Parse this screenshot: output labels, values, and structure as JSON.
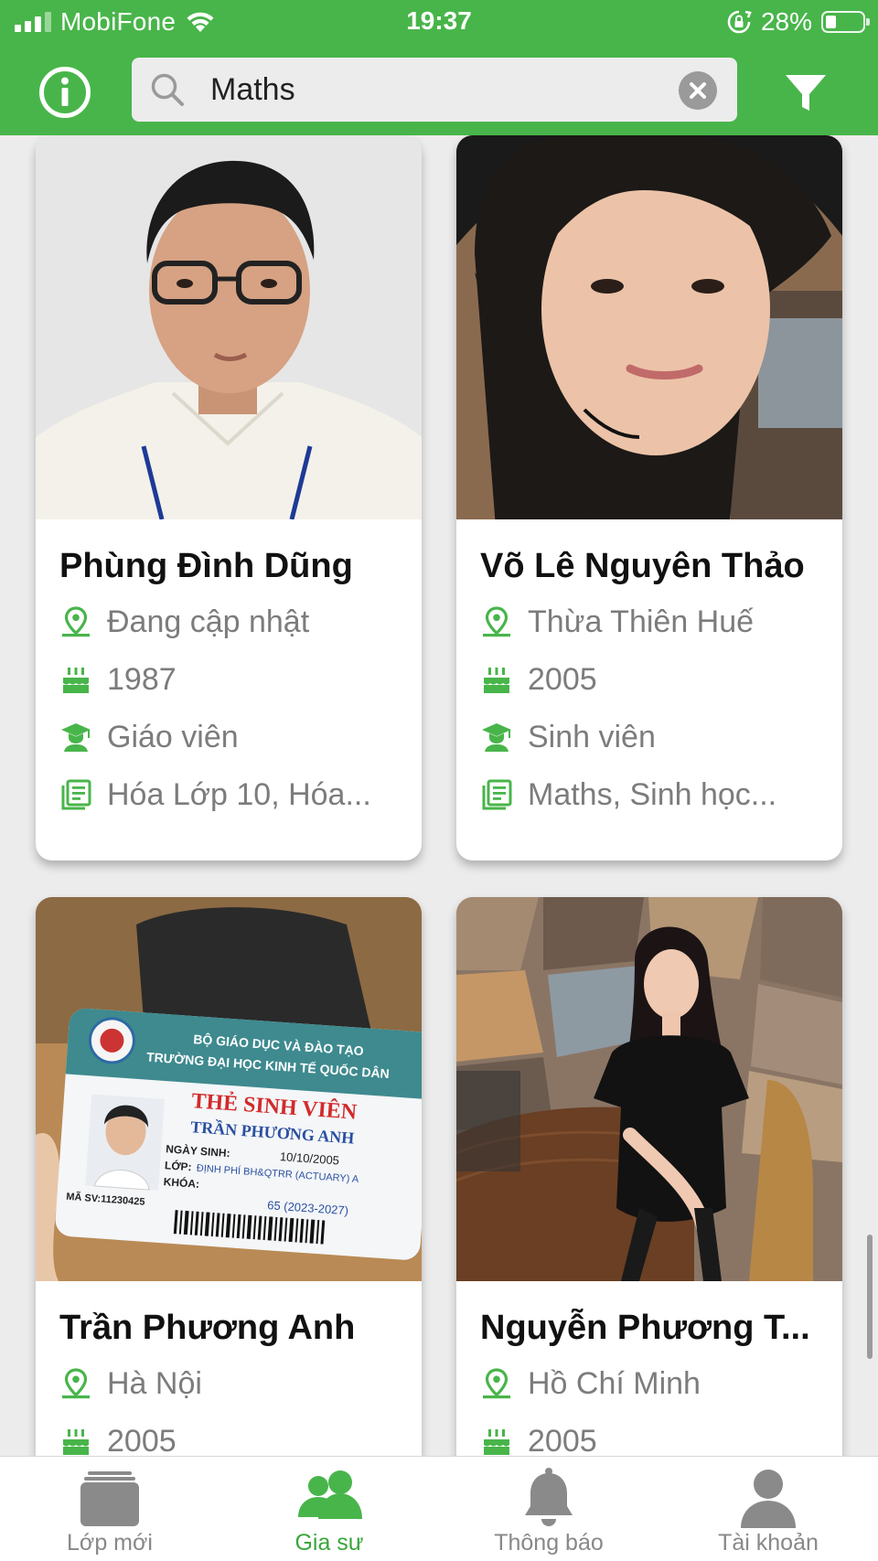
{
  "status_bar": {
    "carrier": "MobiFone",
    "time": "19:37",
    "battery": "28%",
    "battery_level": 0.28
  },
  "search": {
    "value": "Maths",
    "placeholder": ""
  },
  "colors": {
    "brand_green": "#48b54a",
    "icon_green": "#48b54a",
    "inactive_gray": "#888888"
  },
  "tutors": [
    {
      "name": "Phùng Đình Dũng",
      "location": "Đang cập nhật",
      "birth_year": "1987",
      "occupation": "Giáo viên",
      "subjects": "Hóa Lớp 10, Hóa..."
    },
    {
      "name": "Võ Lê Nguyên Thảo",
      "location": "Thừa Thiên Huế",
      "birth_year": "2005",
      "occupation": "Sinh viên",
      "subjects": "Maths, Sinh học..."
    },
    {
      "name": "Trần Phương Anh",
      "location": "Hà Nội",
      "birth_year": "2005",
      "student_card": {
        "ministry": "BỘ GIÁO DỤC VÀ ĐÀO TẠO",
        "university": "TRƯỜNG ĐẠI HỌC KINH TẾ QUỐC DÂN",
        "card_title": "THẺ SINH VIÊN",
        "holder": "TRẦN PHƯƠNG ANH",
        "dob_label": "NGÀY SINH:",
        "dob": "10/10/2005",
        "class_label": "LỚP:",
        "class": "ĐỊNH PHÍ BH&QTRR (ACTUARY) A",
        "course_label": "KHÓA:",
        "course": "65 (2023-2027)",
        "student_id": "MÃ SV:11230425"
      }
    },
    {
      "name": "Nguyễn Phương T...",
      "location": "Hồ Chí Minh",
      "birth_year": "2005"
    }
  ],
  "tabs": [
    {
      "label": "Lớp mới",
      "icon": "folder-icon",
      "active": false
    },
    {
      "label": "Gia sư",
      "icon": "people-icon",
      "active": true
    },
    {
      "label": "Thông báo",
      "icon": "bell-icon",
      "active": false
    },
    {
      "label": "Tài khoản",
      "icon": "person-icon",
      "active": false
    }
  ]
}
